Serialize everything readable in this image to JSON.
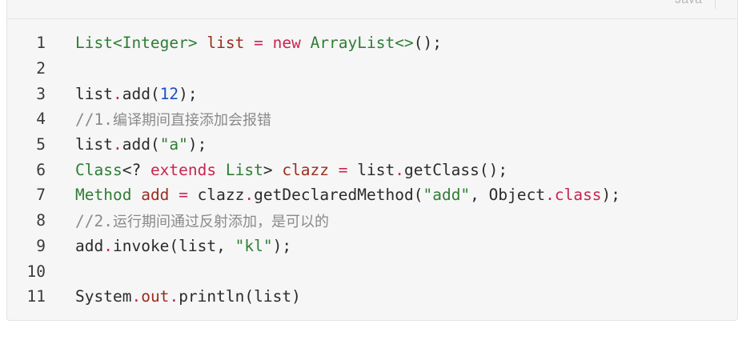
{
  "code_block": {
    "language": "Java",
    "lines": [
      {
        "number": "1",
        "tokens": [
          {
            "t": "List<Integer>",
            "k": "type"
          },
          {
            "t": " ",
            "k": "plain"
          },
          {
            "t": "list",
            "k": "var"
          },
          {
            "t": " ",
            "k": "plain"
          },
          {
            "t": "=",
            "k": "op"
          },
          {
            "t": " ",
            "k": "plain"
          },
          {
            "t": "new",
            "k": "kw"
          },
          {
            "t": " ",
            "k": "plain"
          },
          {
            "t": "ArrayList<>",
            "k": "type"
          },
          {
            "t": "();",
            "k": "plain"
          }
        ]
      },
      {
        "number": "2",
        "tokens": []
      },
      {
        "number": "3",
        "tokens": [
          {
            "t": "list",
            "k": "plain"
          },
          {
            "t": ".",
            "k": "op"
          },
          {
            "t": "add(",
            "k": "plain"
          },
          {
            "t": "12",
            "k": "num"
          },
          {
            "t": ");",
            "k": "plain"
          }
        ]
      },
      {
        "number": "4",
        "tokens": [
          {
            "t": "//1.",
            "k": "cmt"
          },
          {
            "t": "编译期间直接添加会报错",
            "k": "cmt-cjk"
          }
        ]
      },
      {
        "number": "5",
        "tokens": [
          {
            "t": "list",
            "k": "plain"
          },
          {
            "t": ".",
            "k": "op"
          },
          {
            "t": "add(",
            "k": "plain"
          },
          {
            "t": "\"a\"",
            "k": "str"
          },
          {
            "t": ");",
            "k": "plain"
          }
        ]
      },
      {
        "number": "6",
        "tokens": [
          {
            "t": "Class",
            "k": "type"
          },
          {
            "t": "<? ",
            "k": "plain"
          },
          {
            "t": "extends",
            "k": "kw"
          },
          {
            "t": " ",
            "k": "plain"
          },
          {
            "t": "List",
            "k": "type"
          },
          {
            "t": "> ",
            "k": "plain"
          },
          {
            "t": "clazz",
            "k": "var"
          },
          {
            "t": " ",
            "k": "plain"
          },
          {
            "t": "=",
            "k": "op"
          },
          {
            "t": " list",
            "k": "plain"
          },
          {
            "t": ".",
            "k": "op"
          },
          {
            "t": "getClass();",
            "k": "plain"
          }
        ]
      },
      {
        "number": "7",
        "tokens": [
          {
            "t": "Method",
            "k": "type"
          },
          {
            "t": " ",
            "k": "plain"
          },
          {
            "t": "add",
            "k": "var"
          },
          {
            "t": " ",
            "k": "plain"
          },
          {
            "t": "=",
            "k": "op"
          },
          {
            "t": " clazz",
            "k": "plain"
          },
          {
            "t": ".",
            "k": "op"
          },
          {
            "t": "getDeclaredMethod(",
            "k": "plain"
          },
          {
            "t": "\"add\"",
            "k": "str"
          },
          {
            "t": ", Object",
            "k": "plain"
          },
          {
            "t": ".",
            "k": "op"
          },
          {
            "t": "class",
            "k": "kw"
          },
          {
            "t": ");",
            "k": "plain"
          }
        ]
      },
      {
        "number": "8",
        "tokens": [
          {
            "t": "//2.",
            "k": "cmt"
          },
          {
            "t": "运行期间通过反射添加，是可以的",
            "k": "cmt-cjk"
          }
        ]
      },
      {
        "number": "9",
        "tokens": [
          {
            "t": "add",
            "k": "plain"
          },
          {
            "t": ".",
            "k": "op"
          },
          {
            "t": "invoke(list, ",
            "k": "plain"
          },
          {
            "t": "\"kl\"",
            "k": "str"
          },
          {
            "t": ");",
            "k": "plain"
          }
        ]
      },
      {
        "number": "10",
        "tokens": []
      },
      {
        "number": "11",
        "tokens": [
          {
            "t": "System",
            "k": "plain"
          },
          {
            "t": ".",
            "k": "op"
          },
          {
            "t": "out",
            "k": "var"
          },
          {
            "t": ".",
            "k": "op"
          },
          {
            "t": "println(list)",
            "k": "plain"
          }
        ]
      }
    ]
  }
}
